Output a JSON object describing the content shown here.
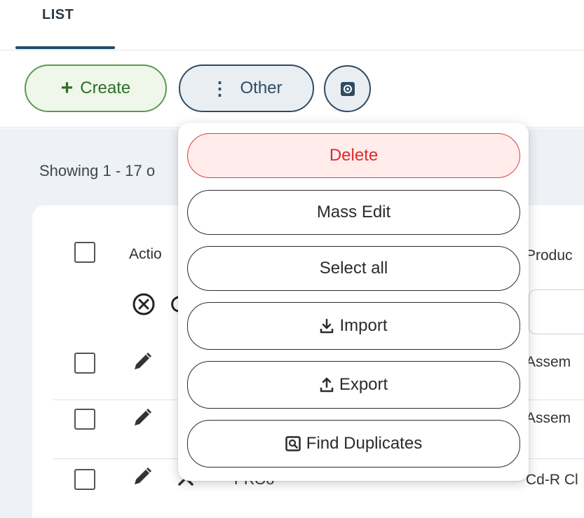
{
  "tabs": {
    "active": "LIST"
  },
  "toolbar": {
    "create_label": "Create",
    "other_label": "Other",
    "settings_icon": "settings-icon"
  },
  "list": {
    "showing_text": "Showing 1 - 17 o",
    "headers": {
      "action": "Actio",
      "product": "Produc"
    },
    "rows": [
      {
        "code": "",
        "product": "Assem"
      },
      {
        "code": "",
        "product": "Assem"
      },
      {
        "code": "PRO8",
        "product": "Cd-R Cl"
      }
    ]
  },
  "menu": {
    "delete_label": "Delete",
    "mass_edit_label": "Mass Edit",
    "select_all_label": "Select all",
    "import_label": "Import",
    "export_label": "Export",
    "find_duplicates_label": "Find Duplicates"
  },
  "colors": {
    "create_accent": "#5a9a52",
    "other_accent": "#2f4c63",
    "delete_accent": "#e23c3c",
    "tab_underline": "#1f4e6a"
  }
}
